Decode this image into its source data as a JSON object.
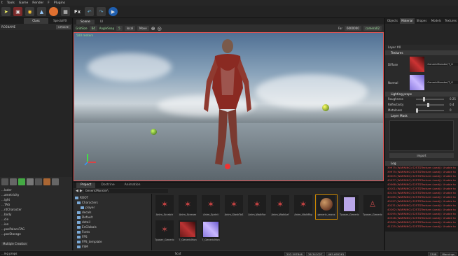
{
  "menubar": {
    "items": [
      "t",
      "Tools",
      "Game",
      "Render",
      "F",
      "Plugins"
    ]
  },
  "toolbar": {
    "fx_label": "Fx"
  },
  "left_panel": {
    "tabs": [
      "",
      "Class",
      "SpecialFX"
    ],
    "name_label": "ROSNAME",
    "update_button": "UPDATE",
    "list": [
      "...lader",
      "...ametricity",
      "...ight",
      "...TAG",
      "...ntCharacter",
      "...body",
      "...cle",
      "...ion",
      "...posPalaceTAG",
      "...posStorage"
    ],
    "bottom_label": "Multiple Creation"
  },
  "center": {
    "tabs": [
      "Scene",
      "UI"
    ],
    "viewport_toolbar": {
      "gridsize_label": "GridSize",
      "gridsize_value": "64",
      "angle_label": "AngleSnap",
      "angle_value": "5",
      "local_label": "local",
      "move_label": "Move",
      "far_label": "Far",
      "far_value": "6000000",
      "camera_label": "camera02"
    },
    "overlay_text": "500 meters"
  },
  "bottom": {
    "tabs": [
      "Project",
      "Doctrine",
      "Animation"
    ],
    "path": "GenericMonster\\",
    "tree": [
      "ROOT",
      "Characters",
      "player",
      "decals",
      "Default",
      "detail",
      "EnGlobals",
      "Fonts",
      "FPS",
      "FPS_template",
      "FSM",
      "fusion"
    ],
    "thumbs": [
      "Anim_Scratch",
      "Anim_Scream",
      "Anim_Sprint",
      "Anim_SlashToS",
      "Anim_WalkFor",
      "Anim_WalkLef",
      "Anim_WalkRig",
      "generic_mons",
      "Tposer_Generic",
      "Tposer_Generic",
      "Tposer_Generic",
      "T_GenericMon",
      "T_GenericMon"
    ]
  },
  "right_panel": {
    "tabs": [
      "Objects",
      "Material",
      "Shapes",
      "Models",
      "Textures"
    ],
    "layer_label": "Layer #0",
    "textures_header": "Textures",
    "diffuse_label": "Diffuse",
    "diffuse_value": "GenericMonster\\T_G",
    "normal_label": "Normal",
    "normal_value": "GenericMonster\\T_G",
    "lighting_header": "Lighting props",
    "roughness_label": "Roughness",
    "roughness_value": "0.25",
    "reflectivity_label": "Reflectivity",
    "reflectivity_value": "0.4",
    "metalness_label": "Metalness",
    "metalness_value": "0",
    "layer_mask_header": "Layer Mask",
    "import_button": "import",
    "log_header": "Log",
    "log_lines": [
      "39975 (WARNING) S2STDTexture::Load(): Unable to",
      "39975 (WARNING) S2STDTexture::Load(): Unable to",
      "40005 (WARNING) S2STDTexture::Load(): Unable to",
      "40037 (WARNING) S2STDTexture::Load(): Unable to",
      "40068 (WARNING) S2STDTexture::Load(): Unable to",
      "40101 (WARNING) S2STDTexture::Load(): Unable to",
      "40134 (WARNING) S2STDTexture::Load(): Unable to",
      "40165 (WARNING) S2STDTexture::Load(): Unable to",
      "40197 (WARNING) S2STDTexture::Load(): Unable to",
      "40231 (WARNING) S2STDTexture::Load(): Unable to",
      "40262 (WARNING) S2STDTexture::Load(): Unable to",
      "40295 (WARNING) S2STDTexture::Load(): Unable to",
      "40328 (WARNING) S2STDTexture::Load(): Unable to",
      "40360 (WARNING) S2STDTexture::Load(): Unable to",
      "41225 (WARNING) S2STDTexture::Load(): Unable to"
    ]
  },
  "statusbar": {
    "left": "...ing props",
    "center": "Scut",
    "field1": "202.597846",
    "field2": "36.341027",
    "field3": "465.695261",
    "field4": "1308",
    "warnings": "Warnings"
  }
}
